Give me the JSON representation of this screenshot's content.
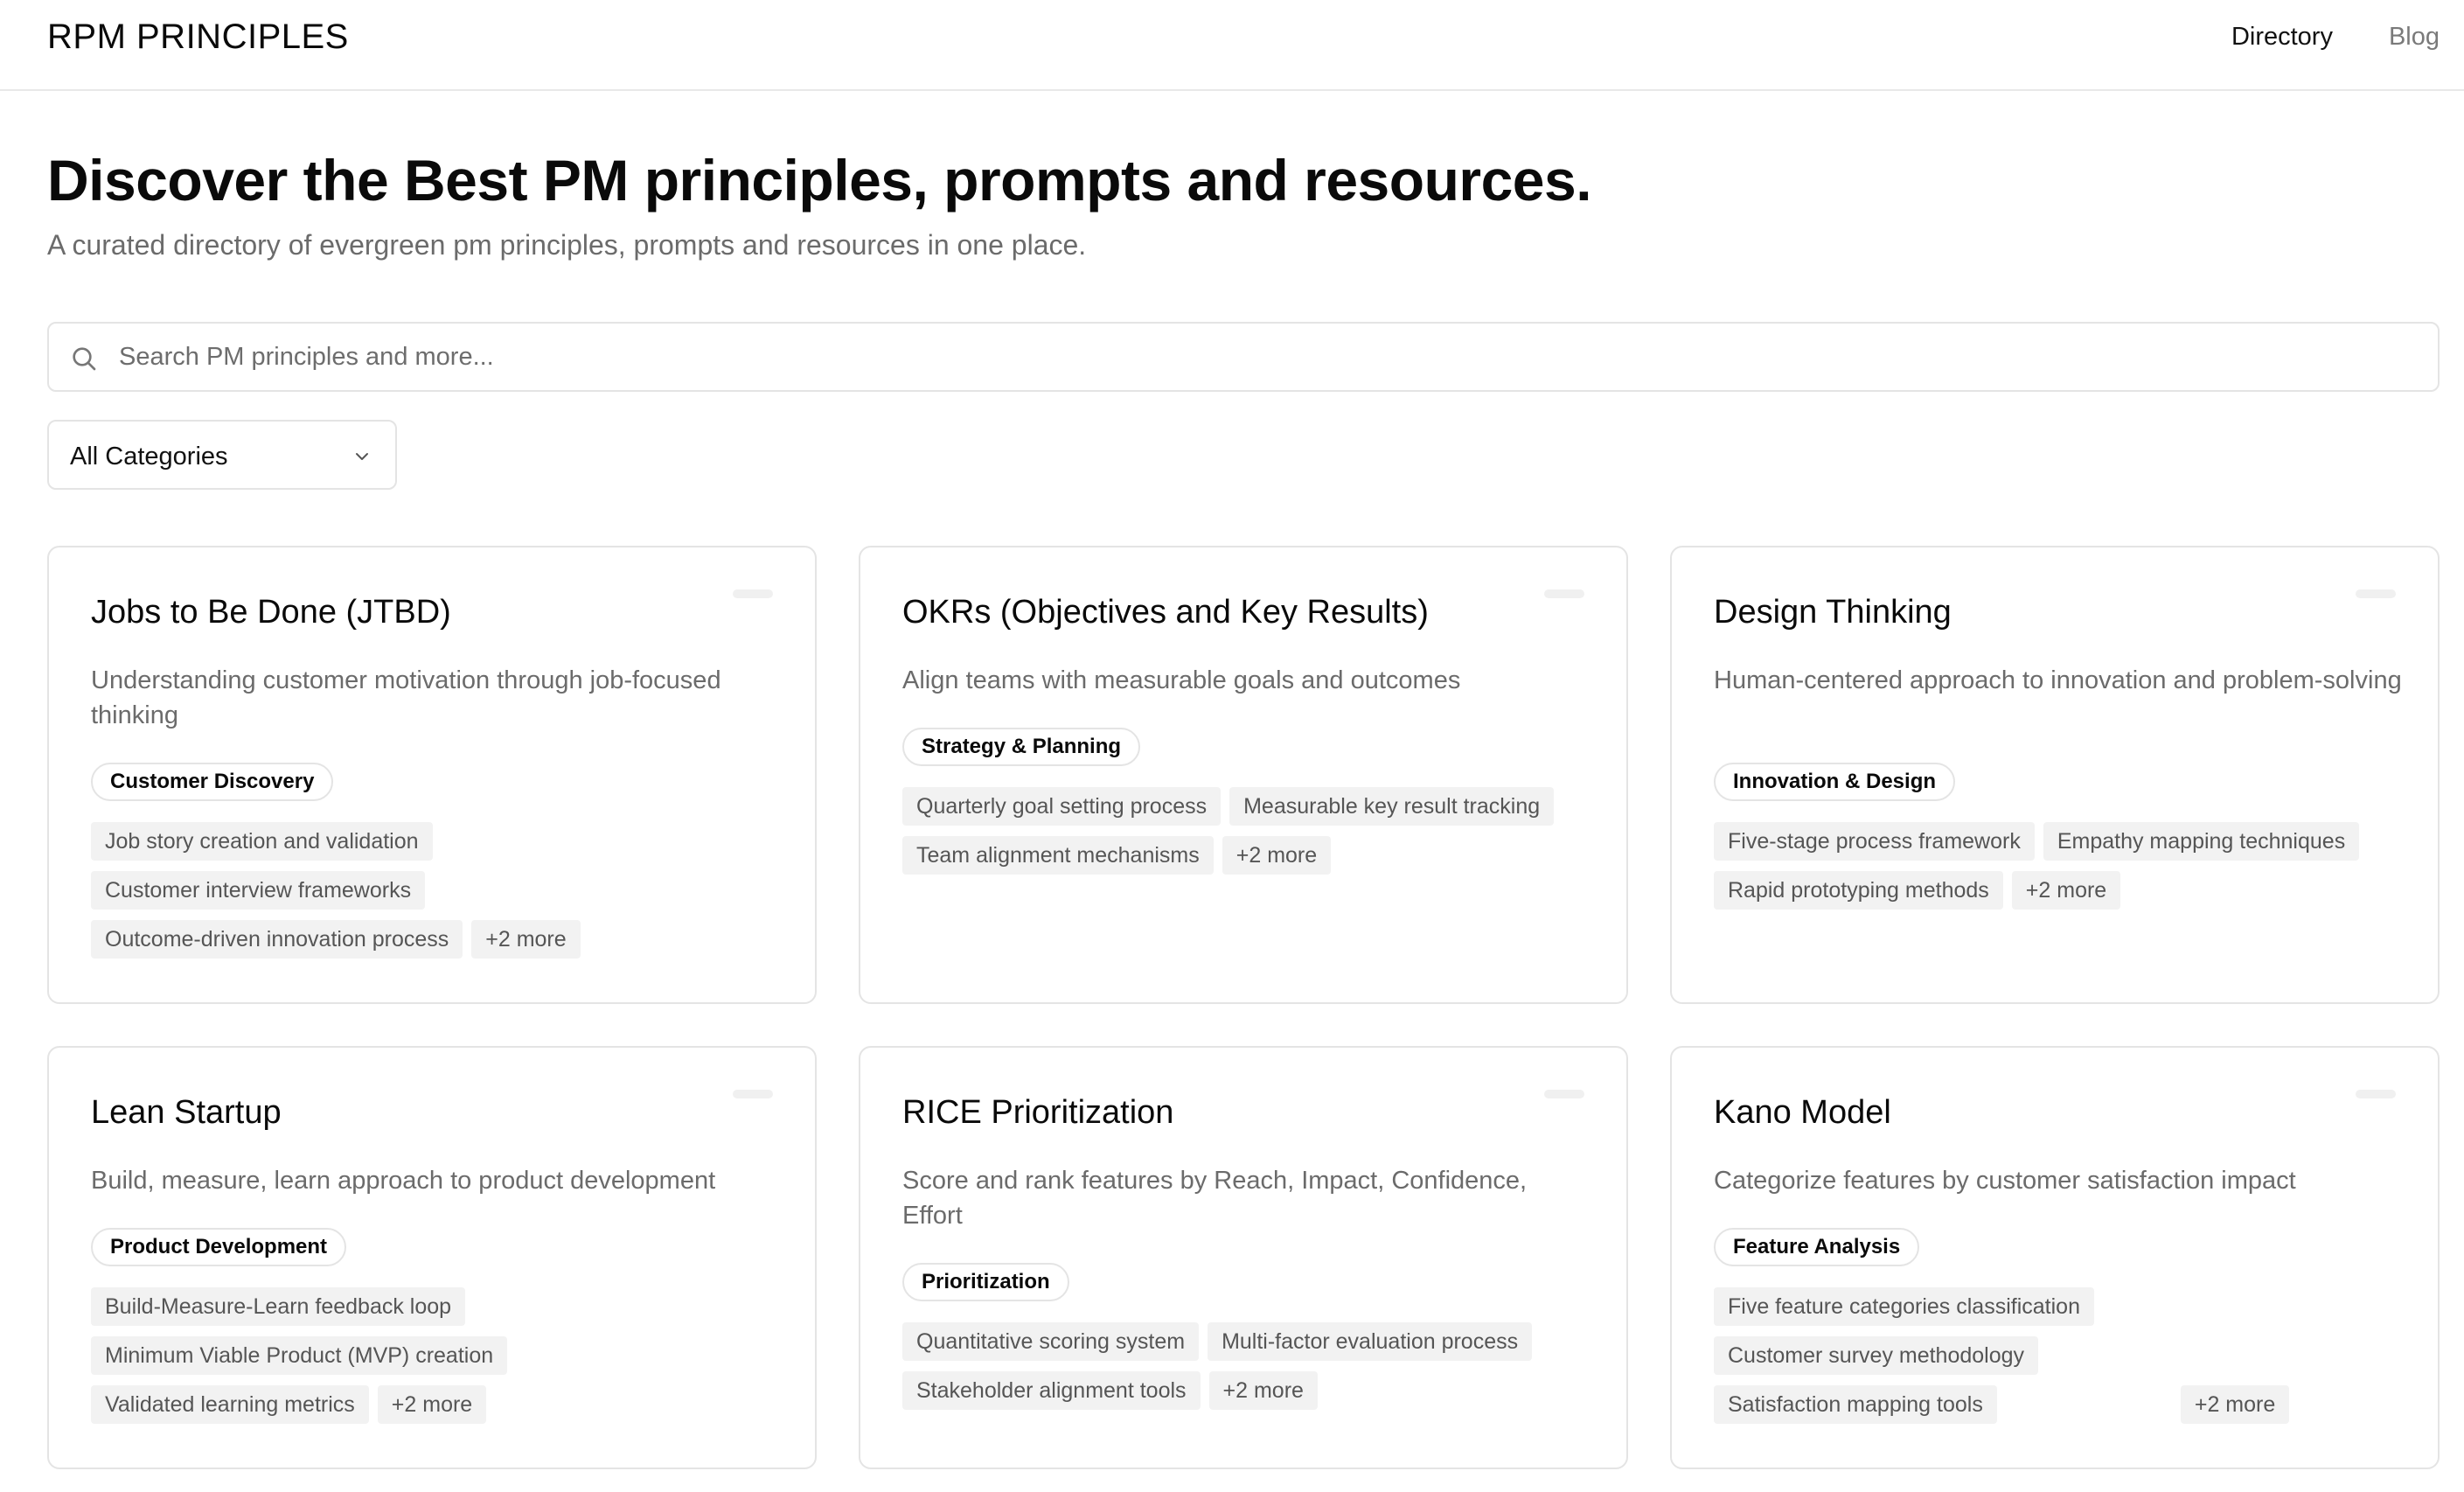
{
  "brand": "RPM PRINCIPLES",
  "nav": {
    "directory": "Directory",
    "blog": "Blog"
  },
  "hero": {
    "title": "Discover the Best PM principles, prompts and resources.",
    "subtitle": "A curated directory of evergreen pm principles, prompts and resources in one place."
  },
  "search": {
    "placeholder": "Search PM principles and more...",
    "value": "",
    "icon": "search-icon"
  },
  "category_filter": {
    "selected": "All Categories",
    "icon": "chevron-down-icon"
  },
  "cards": [
    {
      "title": "Jobs to Be Done (JTBD)",
      "description": "Understanding customer motivation through job-focused thinking",
      "category": "Customer Discovery",
      "features": [
        "Job story creation and validation",
        "Customer interview frameworks",
        "Outcome-driven innovation process"
      ],
      "more": "+2 more"
    },
    {
      "title": "OKRs (Objectives and Key Results)",
      "description": "Align teams with measurable goals and outcomes",
      "category": "Strategy & Planning",
      "features": [
        "Quarterly goal setting process",
        "Measurable key result tracking",
        "Team alignment mechanisms"
      ],
      "more": "+2 more"
    },
    {
      "title": "Design Thinking",
      "description": "Human-centered approach to innovation and problem-solving",
      "category": "Innovation & Design",
      "features": [
        "Five-stage process framework",
        "Empathy mapping techniques",
        "Rapid prototyping methods"
      ],
      "more": "+2 more"
    },
    {
      "title": "Lean Startup",
      "description": "Build, measure, learn approach to product development",
      "category": "Product Development",
      "features": [
        "Build-Measure-Learn feedback loop",
        "Minimum Viable Product (MVP) creation",
        "Validated learning metrics"
      ],
      "more": "+2 more"
    },
    {
      "title": "RICE Prioritization",
      "description": "Score and rank features by Reach, Impact, Confidence, Effort",
      "category": "Prioritization",
      "features": [
        "Quantitative scoring system",
        "Multi-factor evaluation process",
        "Stakeholder alignment tools"
      ],
      "more": "+2 more"
    },
    {
      "title": "Kano Model",
      "description": "Categorize features by customer satisfaction impact",
      "category": "Feature Analysis",
      "features": [
        "Five feature categories classification",
        "Customer survey methodology",
        "Satisfaction mapping tools"
      ],
      "more": "+2 more"
    }
  ]
}
